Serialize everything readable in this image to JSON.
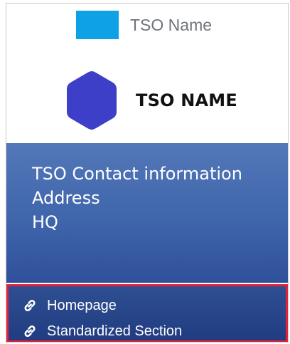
{
  "header": {
    "small_logo_color": "#0ea1e6",
    "small_name": "TSO Name"
  },
  "logo": {
    "shape": "hexagon",
    "color": "#3d3fc8",
    "name": "TSO NAME"
  },
  "contact": {
    "lines": [
      "TSO Contact information",
      "Address",
      "HQ"
    ]
  },
  "links": {
    "highlight_color": "#e3213a",
    "items": [
      {
        "label": "Homepage",
        "icon": "link-icon"
      },
      {
        "label": "Standardized Section",
        "icon": "link-icon"
      }
    ]
  }
}
